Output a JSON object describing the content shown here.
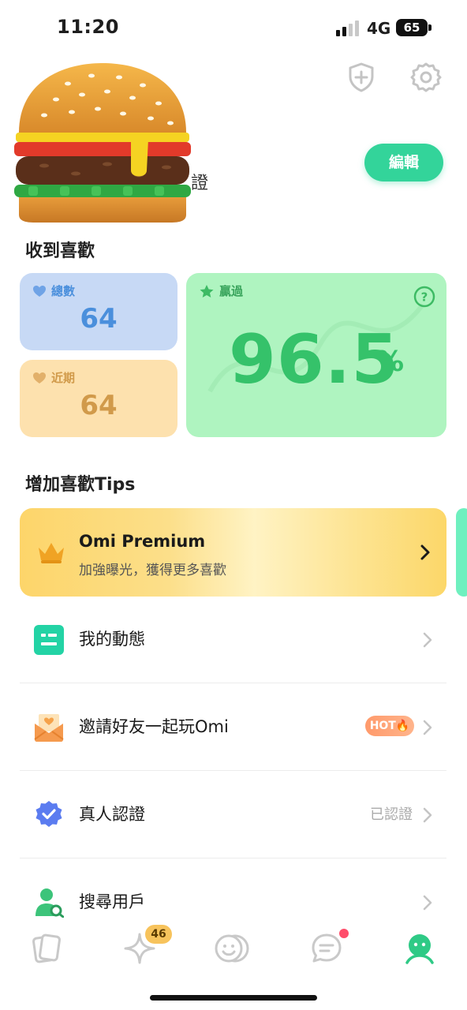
{
  "status_bar": {
    "time": "11:20",
    "network": "4G",
    "battery": "65",
    "signal_icon": "cellular-signal-icon"
  },
  "header": {
    "shield_icon": "shield-plus-icon",
    "settings_icon": "gear-icon",
    "edit_label": "編輯",
    "username_suffix": "證"
  },
  "likes": {
    "title": "收到喜歡",
    "total": {
      "label": "總數",
      "value": "64",
      "color": "#4a8fdc"
    },
    "recent": {
      "label": "近期",
      "value": "64",
      "color": "#d19a4a"
    },
    "beat": {
      "label": "贏過",
      "value": "96.5",
      "unit": "%",
      "color": "#35c26a"
    }
  },
  "tips": {
    "title": "增加喜歡Tips",
    "premium": {
      "title": "Omi Premium",
      "subtitle": "加強曝光，獲得更多喜歡",
      "icon": "crown-icon"
    }
  },
  "menu": [
    {
      "label": "我的動態",
      "icon": "moments-icon"
    },
    {
      "label": "邀請好友一起玩Omi",
      "icon": "invite-envelope-icon",
      "badge": "HOT🔥"
    },
    {
      "label": "真人認證",
      "icon": "verified-badge-icon",
      "status": "已認證"
    },
    {
      "label": "搜尋用戶",
      "icon": "user-search-icon"
    }
  ],
  "tab_bar": {
    "cards_icon": "cards-icon",
    "sparkle_icon": "sparkle-icon",
    "sparkle_badge": "46",
    "match_icon": "smiley-pair-icon",
    "chat_icon": "chat-bubble-icon",
    "profile_icon": "profile-face-icon"
  },
  "colors": {
    "accent": "#33d49a",
    "premium": "#fcd769",
    "inactive_icon": "#c9c9c9"
  }
}
